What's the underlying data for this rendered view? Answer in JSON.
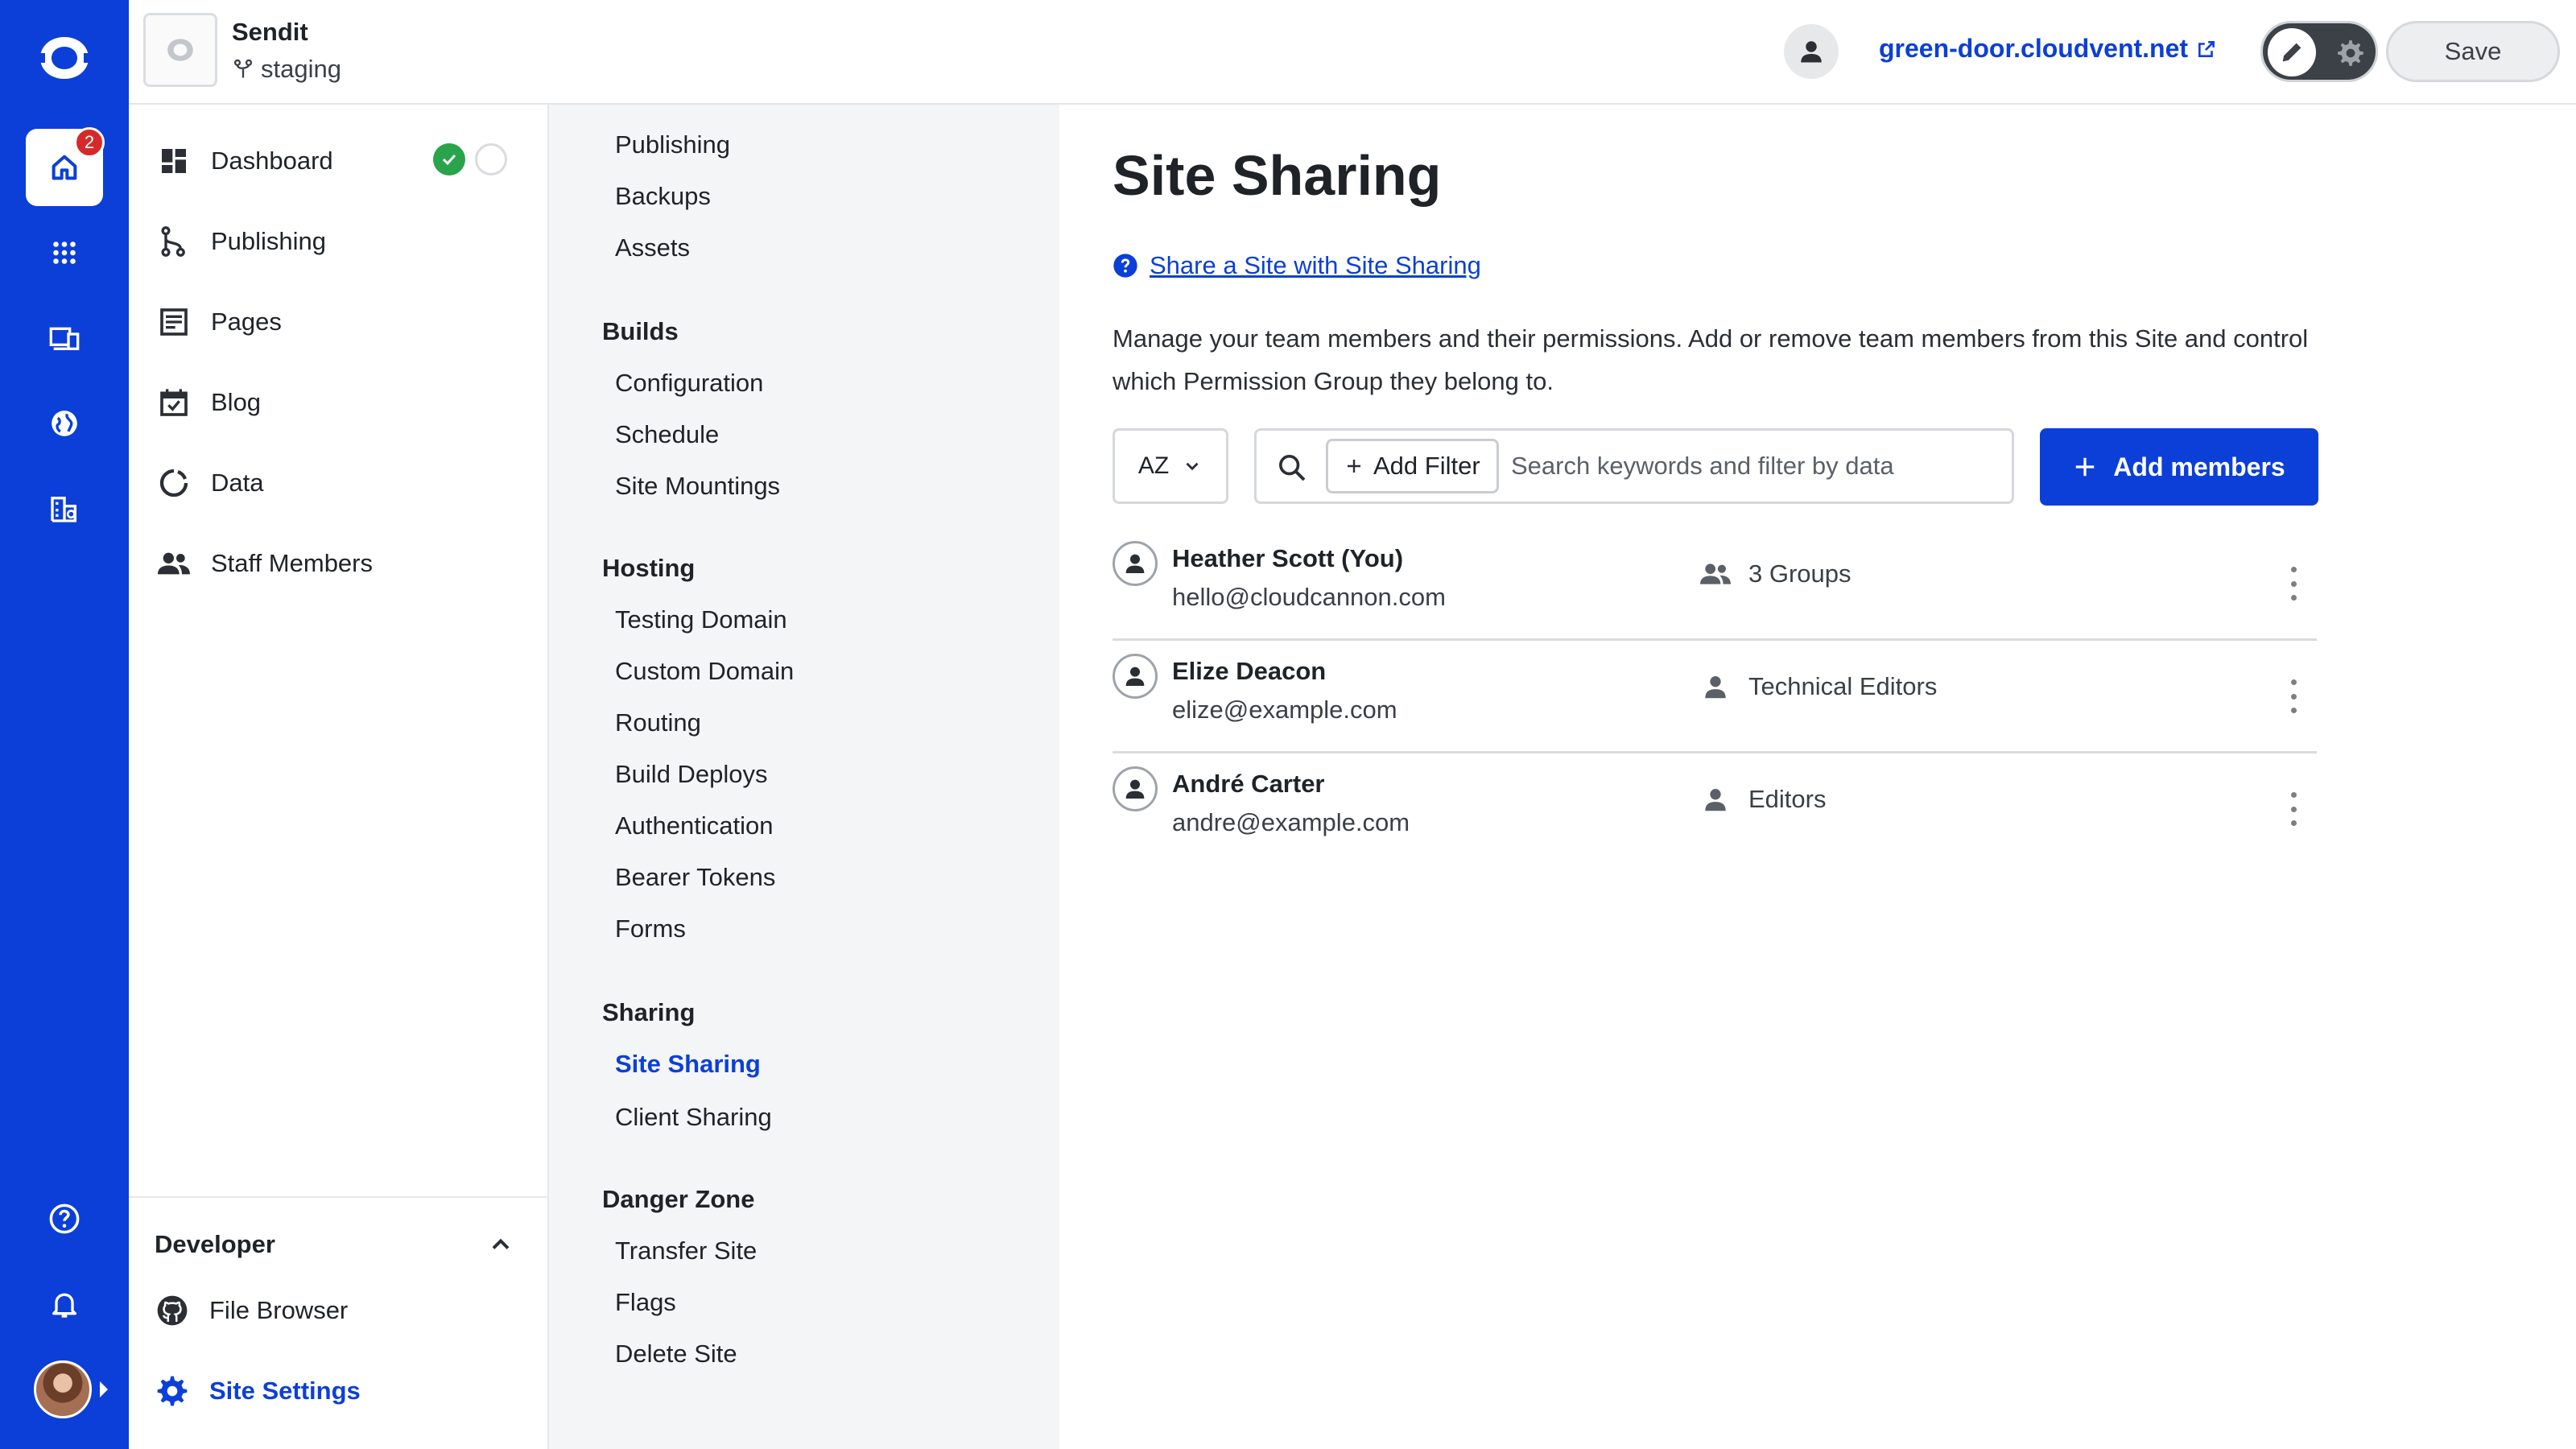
{
  "rail": {
    "home_badge": "2",
    "colors": {
      "background": "#0b3fd8",
      "badge": "#d62a2a"
    }
  },
  "topbar": {
    "site_name": "Sendit",
    "branch": "staging",
    "domain": "green-door.cloudvent.net",
    "save_label": "Save"
  },
  "leftnav": {
    "items": [
      {
        "label": "Dashboard",
        "icon": "dashboard-icon"
      },
      {
        "label": "Publishing",
        "icon": "publishing-icon"
      },
      {
        "label": "Pages",
        "icon": "pages-icon"
      },
      {
        "label": "Blog",
        "icon": "blog-icon"
      },
      {
        "label": "Data",
        "icon": "data-icon"
      },
      {
        "label": "Staff Members",
        "icon": "staff-icon"
      }
    ],
    "developer": {
      "title": "Developer",
      "items": [
        {
          "label": "File Browser",
          "icon": "github-icon"
        },
        {
          "label": "Site Settings",
          "icon": "gear-icon"
        }
      ]
    }
  },
  "settings": {
    "top_items": [
      "Publishing",
      "Backups",
      "Assets"
    ],
    "sections": [
      {
        "title": "Builds",
        "items": [
          "Configuration",
          "Schedule",
          "Site Mountings"
        ]
      },
      {
        "title": "Hosting",
        "items": [
          "Testing Domain",
          "Custom Domain",
          "Routing",
          "Build Deploys",
          "Authentication",
          "Bearer Tokens",
          "Forms"
        ]
      },
      {
        "title": "Sharing",
        "items": [
          "Site Sharing",
          "Client Sharing"
        ]
      },
      {
        "title": "Danger Zone",
        "items": [
          "Transfer Site",
          "Flags",
          "Delete Site"
        ]
      }
    ]
  },
  "main": {
    "title": "Site Sharing",
    "help_link": "Share a Site with Site Sharing",
    "description": "Manage your team members and their permissions. Add or remove team members from this Site and control which Permission Group they belong to.",
    "sort_label": "AZ",
    "add_filter": "Add Filter",
    "search_placeholder": "Search keywords and filter by data",
    "add_members": "Add members",
    "members": [
      {
        "name": "Heather Scott (You)",
        "email": "hello@cloudcannon.com",
        "group": "3 Groups",
        "group_icon": "groups-icon"
      },
      {
        "name": "Elize Deacon",
        "email": "elize@example.com",
        "group": "Technical Editors",
        "group_icon": "person-icon"
      },
      {
        "name": "André Carter",
        "email": "andre@example.com",
        "group": "Editors",
        "group_icon": "person-icon"
      }
    ]
  }
}
